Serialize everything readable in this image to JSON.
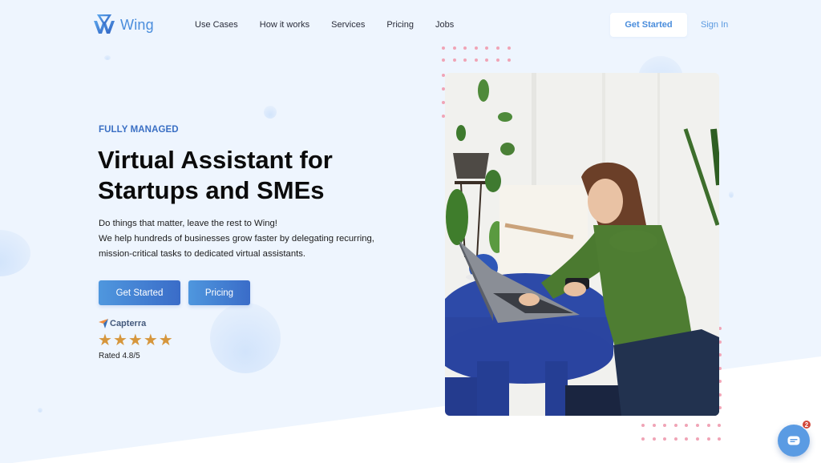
{
  "brand": {
    "name": "Wing",
    "accent": "#4a8ddc"
  },
  "nav": {
    "items": [
      {
        "label": "Use Cases"
      },
      {
        "label": "How it works"
      },
      {
        "label": "Services"
      },
      {
        "label": "Pricing"
      },
      {
        "label": "Jobs"
      }
    ],
    "get_started_label": "Get Started",
    "sign_in_label": "Sign In"
  },
  "hero": {
    "eyebrow": "FULLY MANAGED",
    "headline_line1": "Virtual Assistant for",
    "headline_line2": "Startups and SMEs",
    "sub_line1": "Do things that matter, leave the rest to Wing!",
    "sub_line2": "We help hundreds of businesses grow faster by delegating recurring,",
    "sub_line3": "mission-critical tasks to dedicated virtual assistants.",
    "primary_cta": "Get Started",
    "secondary_cta": "Pricing",
    "review": {
      "platform": "Capterra",
      "stars": 5,
      "rating_text": "Rated 4.8/5",
      "star_color": "#d6963c"
    },
    "image_alt": "Woman in green sweater working on laptop at blue table"
  },
  "chat": {
    "icon": "chat-icon",
    "unread_count": "2"
  }
}
